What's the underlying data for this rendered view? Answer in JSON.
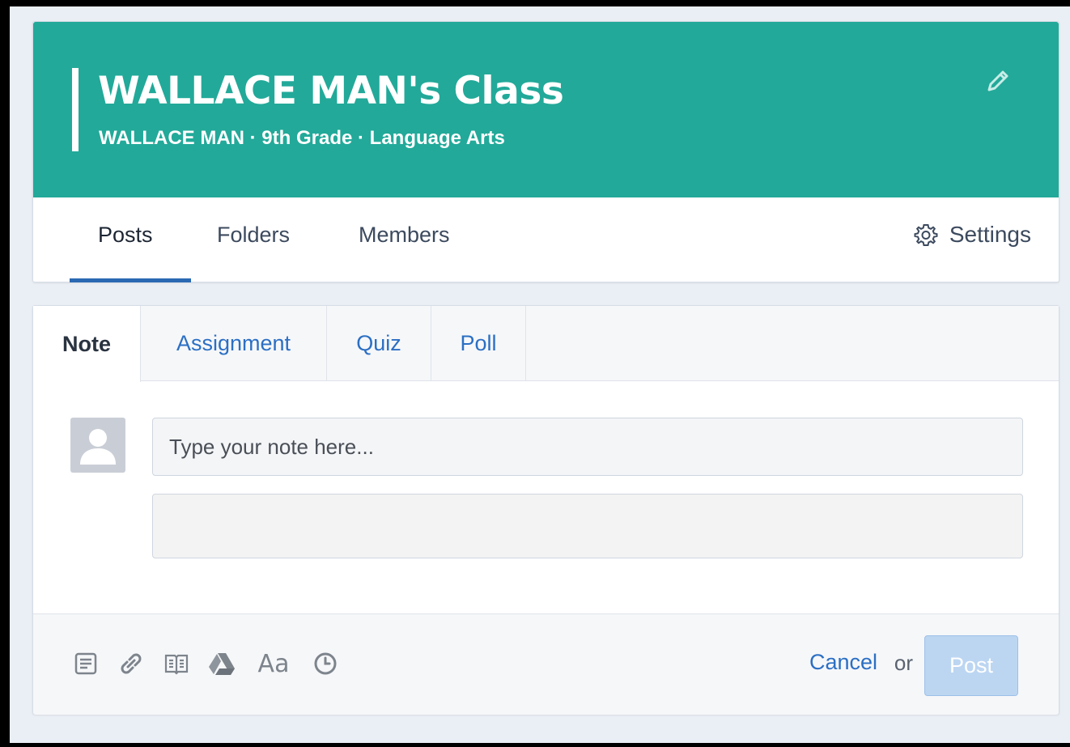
{
  "class": {
    "title": "WALLACE MAN's Class",
    "subtitle": "WALLACE MAN · 9th Grade · Language Arts",
    "banner_color": "#22a999"
  },
  "nav": {
    "tabs": [
      {
        "label": "Posts",
        "active": true
      },
      {
        "label": "Folders",
        "active": false
      },
      {
        "label": "Members",
        "active": false
      }
    ],
    "settings_label": "Settings"
  },
  "composer": {
    "tabs": [
      {
        "label": "Note",
        "active": true
      },
      {
        "label": "Assignment",
        "active": false
      },
      {
        "label": "Quiz",
        "active": false
      },
      {
        "label": "Poll",
        "active": false
      }
    ],
    "note_placeholder": "Type your note here...",
    "tools": [
      "file-icon",
      "link-icon",
      "library-icon",
      "google-drive-icon",
      "font-icon",
      "clock-icon"
    ],
    "font_tool_label": "Aa",
    "cancel_label": "Cancel",
    "or_label": "or",
    "post_label": "Post",
    "accent_color": "#2b6fc4"
  }
}
